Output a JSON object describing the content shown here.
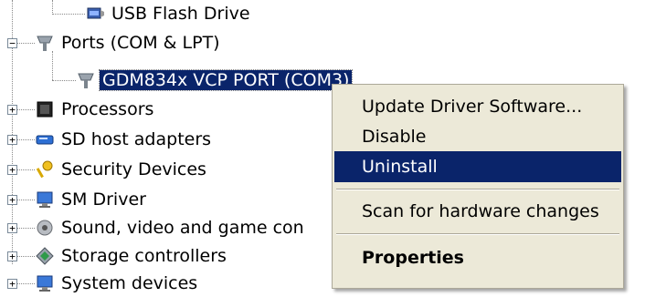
{
  "tree": {
    "items": [
      {
        "label": "USB Flash Drive",
        "icon": "usb-drive-icon"
      },
      {
        "label": "Ports (COM & LPT)",
        "icon": "port-icon",
        "expander": "−"
      },
      {
        "label": "GDM834x VCP PORT (COM3)",
        "icon": "port-icon",
        "selected": true
      },
      {
        "label": "Processors",
        "icon": "processor-icon",
        "expander": "+"
      },
      {
        "label": "SD host adapters",
        "icon": "sd-card-icon",
        "expander": "+"
      },
      {
        "label": "Security Devices",
        "icon": "key-icon",
        "expander": "+"
      },
      {
        "label": "SM Driver",
        "icon": "monitor-icon",
        "expander": "+"
      },
      {
        "label": "Sound, video and game con",
        "icon": "speaker-icon",
        "expander": "+"
      },
      {
        "label": "Storage controllers",
        "icon": "storage-icon",
        "expander": "+"
      },
      {
        "label": "System devices",
        "icon": "monitor-icon",
        "expander": "+"
      }
    ]
  },
  "context_menu": {
    "items": [
      {
        "label": "Update Driver Software..."
      },
      {
        "label": "Disable"
      },
      {
        "label": "Uninstall",
        "highlighted": true
      },
      {
        "label": "Scan for hardware changes"
      },
      {
        "label": "Properties",
        "bold": true
      }
    ]
  },
  "colors": {
    "selection": "#0a246a",
    "menu_background": "#ece9d8"
  }
}
